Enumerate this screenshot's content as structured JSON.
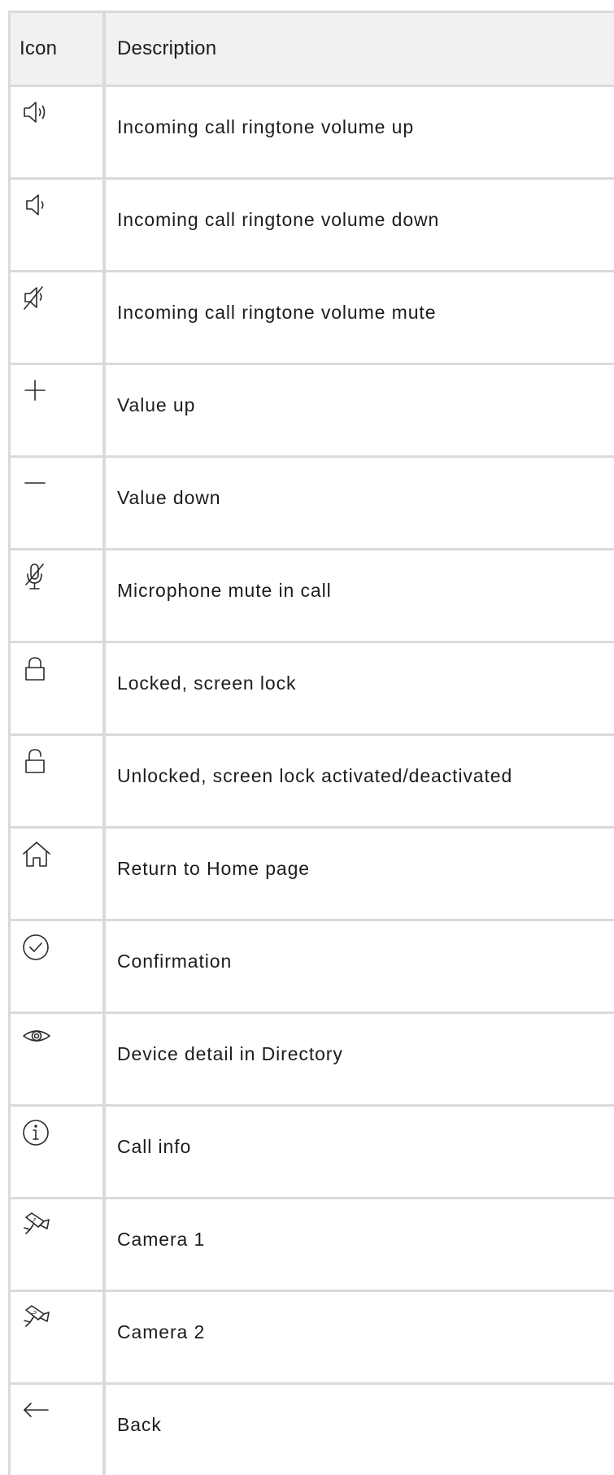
{
  "table": {
    "headers": {
      "icon": "Icon",
      "description": "Description"
    },
    "rows": [
      {
        "icon": "speaker-volume-up-icon",
        "description": "Incoming call ringtone volume up"
      },
      {
        "icon": "speaker-volume-down-icon",
        "description": "Incoming call ringtone volume down"
      },
      {
        "icon": "speaker-mute-icon",
        "description": "Incoming call ringtone volume mute"
      },
      {
        "icon": "plus-icon",
        "description": "Value up"
      },
      {
        "icon": "minus-icon",
        "description": "Value down"
      },
      {
        "icon": "microphone-mute-icon",
        "description": "Microphone mute in call"
      },
      {
        "icon": "lock-closed-icon",
        "description": "Locked, screen lock"
      },
      {
        "icon": "lock-open-icon",
        "description": "Unlocked, screen lock activated/deactivated"
      },
      {
        "icon": "home-icon",
        "description": "Return to Home page"
      },
      {
        "icon": "check-circle-icon",
        "description": "Confirmation"
      },
      {
        "icon": "eye-icon",
        "description": "Device detail in Directory"
      },
      {
        "icon": "info-circle-icon",
        "description": "Call info"
      },
      {
        "icon": "camera-1-icon",
        "description": "Camera 1"
      },
      {
        "icon": "camera-2-icon",
        "description": "Camera 2"
      },
      {
        "icon": "arrow-left-icon",
        "description": "Back"
      }
    ],
    "camera_labels": [
      "1",
      "2"
    ]
  }
}
